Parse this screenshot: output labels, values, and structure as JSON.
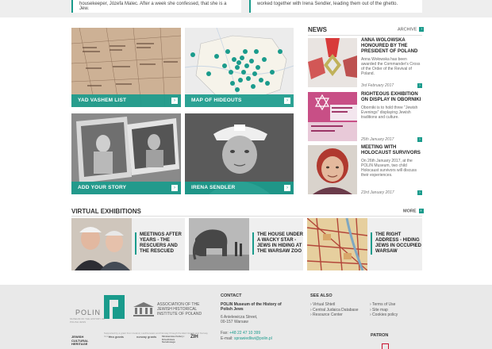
{
  "top": {
    "left_text": "housekeeper, Józefa Malec. After a week she confessed, that she is a Jew.",
    "right_text": "worked together with Irena Sendler, leading them out of the ghetto."
  },
  "tiles": [
    {
      "label": "YAD VASHEM LIST"
    },
    {
      "label": "MAP OF HIDEOUTS"
    },
    {
      "label": "ADD YOUR STORY"
    },
    {
      "label": "IRENA SENDLER"
    }
  ],
  "news": {
    "title": "NEWS",
    "archive_label": "ARCHIVE",
    "items": [
      {
        "title": "ANNA WOLOWSKA HONOURED BY THE PRESIDENT OF POLAND",
        "text": "Anna Wołowska has been awarded the Commander's Cross of the Order of the Revival of Poland.",
        "date": "3rd February 2017"
      },
      {
        "title": "RIGHTEOUS EXHIBITION ON DISPLAY IN OBORNIKI",
        "text": "Oborniki is to hold three \"Jewish Evenings\" displaying Jewish traditions and culture.",
        "date": "25th January 2017"
      },
      {
        "title": "MEETING WITH HOLOCAUST SURVIVORS",
        "text": "On 26th January 2017, at the POLIN Museum, two child Holocaust survivors will discuss their experiences.",
        "date": "23rd January 2017"
      }
    ]
  },
  "exhibitions": {
    "title": "VIRTUAL EXHIBITIONS",
    "more_label": "MORE",
    "items": [
      {
        "title": "MEETINGS AFTER YEARS - THE RESCUERS AND THE RESCUED"
      },
      {
        "title": "THE HOUSE UNDER A WACKY STAR - JEWS IN HIDING AT THE WARSAW ZOO"
      },
      {
        "title": "THE RIGHT ADDRESS - HIDING JEWS IN OCCUPIED WARSAW"
      }
    ]
  },
  "footer": {
    "polin_word": "POLIN",
    "polin_sub": "MUSEUM OF THE HISTORY OF POLISH JEWS",
    "association": "ASSOCIATION OF THE JEWISH HISTORICAL INSTITUTE OF POLAND",
    "supported": "Supported by a grant from Iceland, Liechtenstein and Norway through the EEA Grants and Norway Grants",
    "partner_logos": [
      "JEWISH CULTURAL HERITAGE",
      "eea grants",
      "norway grants",
      "Ministerstwo Kultury i Dziedzictwa Narodowego",
      "ŻIH"
    ],
    "contact": {
      "heading": "CONTACT",
      "org": "POLIN Museum of the History of Polish Jews",
      "street": "6 Anielewicza Street,",
      "city": "00-157 Warsaw",
      "fax_label": "Fax:",
      "fax": "+48 22 47 10 399",
      "email_label": "E-mail:",
      "email": "sprawiedliwi@polin.pl"
    },
    "see_also": {
      "heading": "SEE ALSO",
      "links": [
        "› Virtual Shtetl",
        "› Central Judaica Database",
        "› Resource Center"
      ]
    },
    "policies": [
      "› Terms of Use",
      "› Site map",
      "› Cookies policy"
    ],
    "patron_heading": "PATRON"
  },
  "colors": {
    "accent": "#1a9b8c",
    "footer_bg": "#e9e9e9"
  }
}
